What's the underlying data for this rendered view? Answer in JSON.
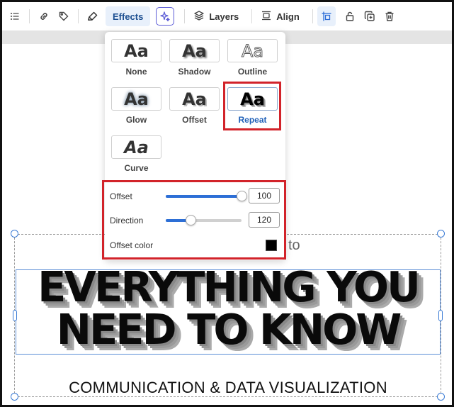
{
  "toolbar": {
    "effects_label": "Effects",
    "layers_label": "Layers",
    "align_label": "Align",
    "icons": [
      "list-icon",
      "link-icon",
      "tag-icon",
      "highlighter-icon",
      "sparkle-icon",
      "layers-icon",
      "align-icon",
      "position-icon",
      "lock-icon",
      "duplicate-icon",
      "trash-icon"
    ]
  },
  "effects": {
    "items": [
      {
        "label": "None",
        "sample": "Aa"
      },
      {
        "label": "Shadow",
        "sample": "Aa"
      },
      {
        "label": "Outline",
        "sample": "Aa"
      },
      {
        "label": "Glow",
        "sample": "Aa"
      },
      {
        "label": "Offset",
        "sample": "Aa"
      },
      {
        "label": "Repeat",
        "sample": "Aa",
        "selected": true
      },
      {
        "label": "Curve",
        "sample": "Aa"
      }
    ],
    "controls": {
      "offset": {
        "label": "Offset",
        "value": "100",
        "fraction": 1.0
      },
      "direction": {
        "label": "Direction",
        "value": "120",
        "fraction": 0.33
      },
      "offset_color": {
        "label": "Offset color",
        "color": "#000000"
      }
    }
  },
  "canvas": {
    "fragment": "to",
    "headline_line1": "EVERYTHING YOU",
    "headline_line2": "NEED TO KNOW",
    "subtitle": "COMMUNICATION & DATA VISUALIZATION"
  },
  "colors": {
    "accent": "#2d6fd6",
    "highlight_box": "#d2232a",
    "selection": "#3a7bd5"
  }
}
